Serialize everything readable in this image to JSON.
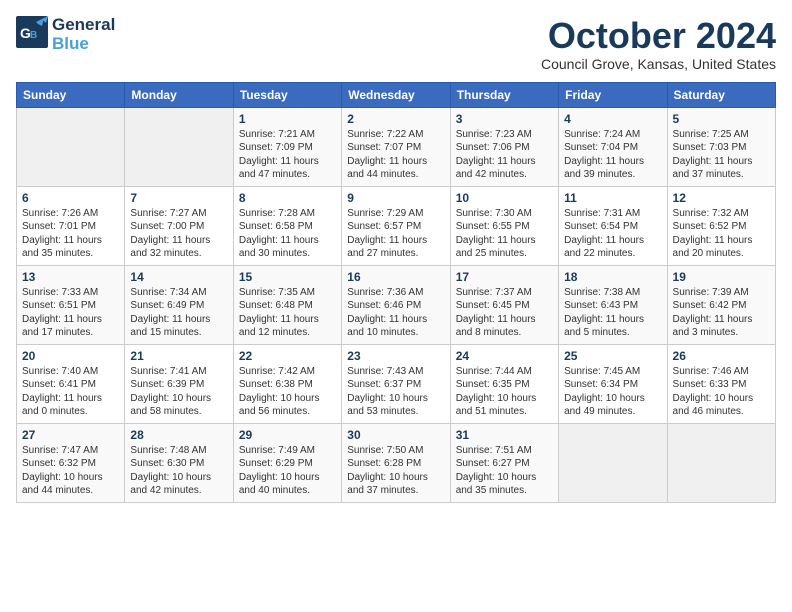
{
  "logo": {
    "line1": "General",
    "line2": "Blue"
  },
  "title": "October 2024",
  "location": "Council Grove, Kansas, United States",
  "days_of_week": [
    "Sunday",
    "Monday",
    "Tuesday",
    "Wednesday",
    "Thursday",
    "Friday",
    "Saturday"
  ],
  "weeks": [
    [
      {
        "day": "",
        "info": ""
      },
      {
        "day": "",
        "info": ""
      },
      {
        "day": "1",
        "info": "Sunrise: 7:21 AM\nSunset: 7:09 PM\nDaylight: 11 hours and 47 minutes."
      },
      {
        "day": "2",
        "info": "Sunrise: 7:22 AM\nSunset: 7:07 PM\nDaylight: 11 hours and 44 minutes."
      },
      {
        "day": "3",
        "info": "Sunrise: 7:23 AM\nSunset: 7:06 PM\nDaylight: 11 hours and 42 minutes."
      },
      {
        "day": "4",
        "info": "Sunrise: 7:24 AM\nSunset: 7:04 PM\nDaylight: 11 hours and 39 minutes."
      },
      {
        "day": "5",
        "info": "Sunrise: 7:25 AM\nSunset: 7:03 PM\nDaylight: 11 hours and 37 minutes."
      }
    ],
    [
      {
        "day": "6",
        "info": "Sunrise: 7:26 AM\nSunset: 7:01 PM\nDaylight: 11 hours and 35 minutes."
      },
      {
        "day": "7",
        "info": "Sunrise: 7:27 AM\nSunset: 7:00 PM\nDaylight: 11 hours and 32 minutes."
      },
      {
        "day": "8",
        "info": "Sunrise: 7:28 AM\nSunset: 6:58 PM\nDaylight: 11 hours and 30 minutes."
      },
      {
        "day": "9",
        "info": "Sunrise: 7:29 AM\nSunset: 6:57 PM\nDaylight: 11 hours and 27 minutes."
      },
      {
        "day": "10",
        "info": "Sunrise: 7:30 AM\nSunset: 6:55 PM\nDaylight: 11 hours and 25 minutes."
      },
      {
        "day": "11",
        "info": "Sunrise: 7:31 AM\nSunset: 6:54 PM\nDaylight: 11 hours and 22 minutes."
      },
      {
        "day": "12",
        "info": "Sunrise: 7:32 AM\nSunset: 6:52 PM\nDaylight: 11 hours and 20 minutes."
      }
    ],
    [
      {
        "day": "13",
        "info": "Sunrise: 7:33 AM\nSunset: 6:51 PM\nDaylight: 11 hours and 17 minutes."
      },
      {
        "day": "14",
        "info": "Sunrise: 7:34 AM\nSunset: 6:49 PM\nDaylight: 11 hours and 15 minutes."
      },
      {
        "day": "15",
        "info": "Sunrise: 7:35 AM\nSunset: 6:48 PM\nDaylight: 11 hours and 12 minutes."
      },
      {
        "day": "16",
        "info": "Sunrise: 7:36 AM\nSunset: 6:46 PM\nDaylight: 11 hours and 10 minutes."
      },
      {
        "day": "17",
        "info": "Sunrise: 7:37 AM\nSunset: 6:45 PM\nDaylight: 11 hours and 8 minutes."
      },
      {
        "day": "18",
        "info": "Sunrise: 7:38 AM\nSunset: 6:43 PM\nDaylight: 11 hours and 5 minutes."
      },
      {
        "day": "19",
        "info": "Sunrise: 7:39 AM\nSunset: 6:42 PM\nDaylight: 11 hours and 3 minutes."
      }
    ],
    [
      {
        "day": "20",
        "info": "Sunrise: 7:40 AM\nSunset: 6:41 PM\nDaylight: 11 hours and 0 minutes."
      },
      {
        "day": "21",
        "info": "Sunrise: 7:41 AM\nSunset: 6:39 PM\nDaylight: 10 hours and 58 minutes."
      },
      {
        "day": "22",
        "info": "Sunrise: 7:42 AM\nSunset: 6:38 PM\nDaylight: 10 hours and 56 minutes."
      },
      {
        "day": "23",
        "info": "Sunrise: 7:43 AM\nSunset: 6:37 PM\nDaylight: 10 hours and 53 minutes."
      },
      {
        "day": "24",
        "info": "Sunrise: 7:44 AM\nSunset: 6:35 PM\nDaylight: 10 hours and 51 minutes."
      },
      {
        "day": "25",
        "info": "Sunrise: 7:45 AM\nSunset: 6:34 PM\nDaylight: 10 hours and 49 minutes."
      },
      {
        "day": "26",
        "info": "Sunrise: 7:46 AM\nSunset: 6:33 PM\nDaylight: 10 hours and 46 minutes."
      }
    ],
    [
      {
        "day": "27",
        "info": "Sunrise: 7:47 AM\nSunset: 6:32 PM\nDaylight: 10 hours and 44 minutes."
      },
      {
        "day": "28",
        "info": "Sunrise: 7:48 AM\nSunset: 6:30 PM\nDaylight: 10 hours and 42 minutes."
      },
      {
        "day": "29",
        "info": "Sunrise: 7:49 AM\nSunset: 6:29 PM\nDaylight: 10 hours and 40 minutes."
      },
      {
        "day": "30",
        "info": "Sunrise: 7:50 AM\nSunset: 6:28 PM\nDaylight: 10 hours and 37 minutes."
      },
      {
        "day": "31",
        "info": "Sunrise: 7:51 AM\nSunset: 6:27 PM\nDaylight: 10 hours and 35 minutes."
      },
      {
        "day": "",
        "info": ""
      },
      {
        "day": "",
        "info": ""
      }
    ]
  ]
}
